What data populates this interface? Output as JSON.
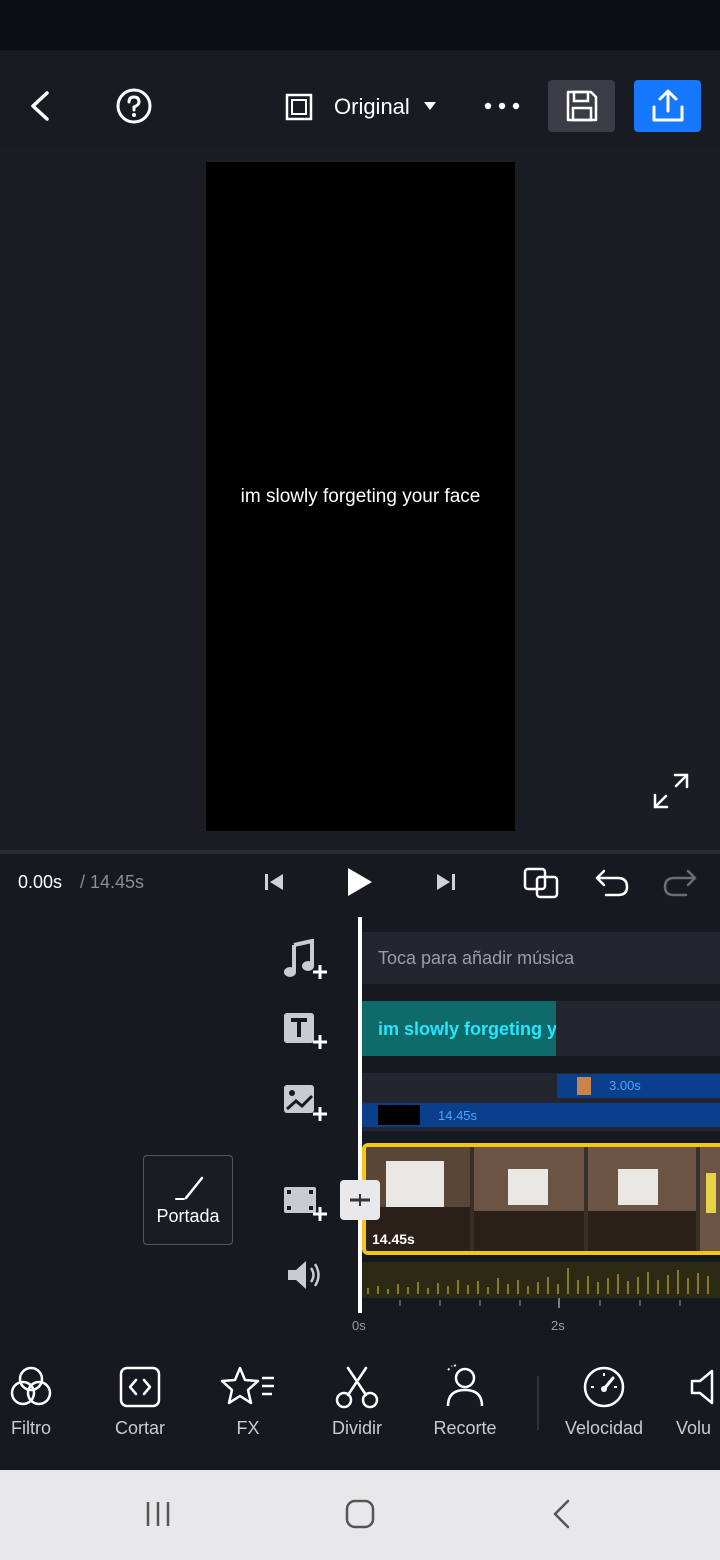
{
  "header": {
    "aspect_label": "Original",
    "back_icon": "back-arrow-icon",
    "help_icon": "help-icon",
    "more_icon": "more-icon",
    "save_icon": "save-icon",
    "export_icon": "export-icon"
  },
  "preview": {
    "caption": "im slowly forgeting your face"
  },
  "playback": {
    "current_time": "0.00s",
    "total_time": "/ 14.45s"
  },
  "tracks": {
    "music_placeholder": "Toca para añadir música",
    "text_clip": "im slowly forgeting yo",
    "overlay_clip_1_duration": "3.00s",
    "overlay_clip_2_duration": "14.45s",
    "video_duration": "14.45s",
    "cover_label": "Portada"
  },
  "ruler": {
    "tick_0": "0s",
    "tick_2": "2s"
  },
  "toolbar": {
    "items": [
      {
        "label": "Filtro"
      },
      {
        "label": "Cortar"
      },
      {
        "label": "FX"
      },
      {
        "label": "Dividir"
      },
      {
        "label": "Recorte"
      },
      {
        "label": "Velocidad"
      },
      {
        "label": "Volu"
      }
    ]
  },
  "colors": {
    "accent_blue": "#1677ff",
    "clip_blue": "#0a3f8c",
    "text_clip_teal": "#0f6a6a",
    "selection_yellow": "#f5c518"
  }
}
